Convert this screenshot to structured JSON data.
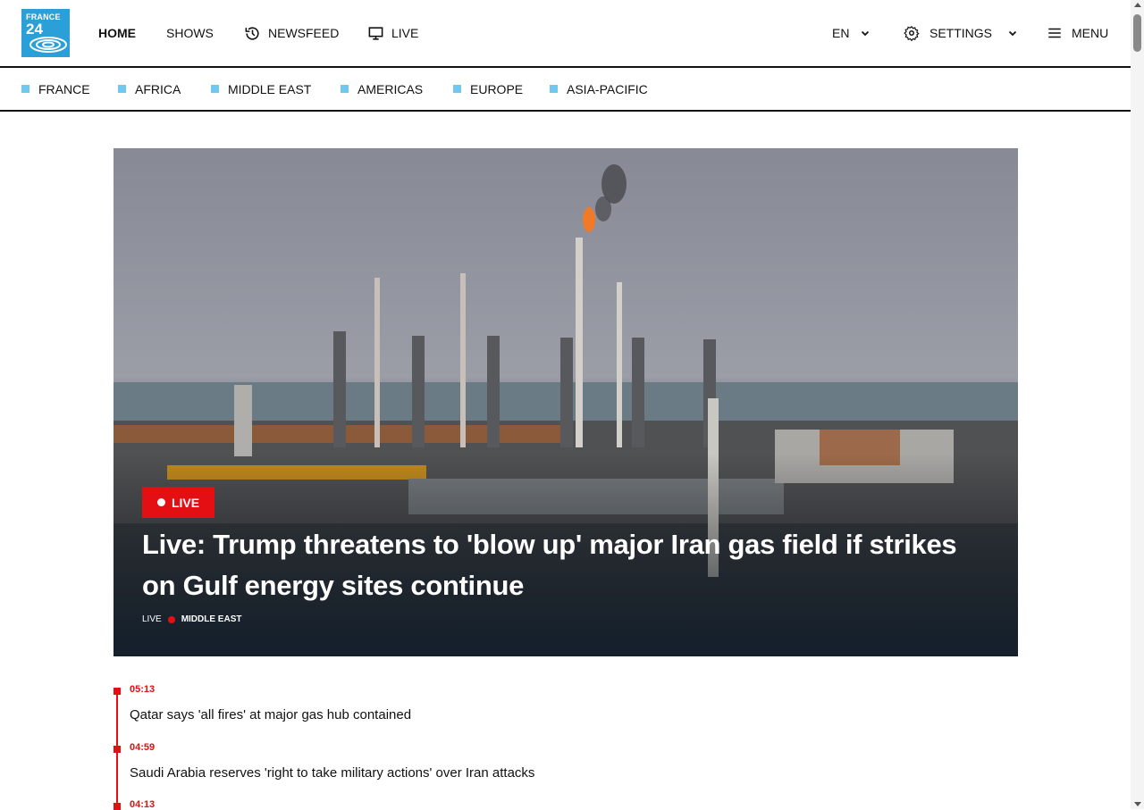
{
  "logo": {
    "line1": "FRANCE",
    "line2": "24",
    "color": "#2a9fd8"
  },
  "nav": {
    "home": "HOME",
    "shows": "SHOWS",
    "newsfeed": "NEWSFEED",
    "live": "LIVE",
    "language": "EN",
    "settings": "SETTINGS",
    "menu": "MENU"
  },
  "regions": [
    "FRANCE",
    "AFRICA",
    "MIDDLE EAST",
    "AMERICAS",
    "EUROPE",
    "ASIA-PACIFIC"
  ],
  "hero": {
    "badge": "LIVE",
    "title": "Live: Trump threatens to 'blow up' major Iran gas field if strikes on Gulf energy sites continue",
    "meta_live": "LIVE",
    "meta_category": "MIDDLE EAST"
  },
  "timeline": [
    {
      "time": "05:13",
      "headline": "Qatar says 'all fires' at major gas hub contained"
    },
    {
      "time": "04:59",
      "headline": "Saudi Arabia reserves 'right to take military actions' over Iran attacks"
    },
    {
      "time": "04:13",
      "headline": ""
    }
  ],
  "colors": {
    "accent_red": "#e30f13",
    "region_square": "#6ec8f0"
  }
}
